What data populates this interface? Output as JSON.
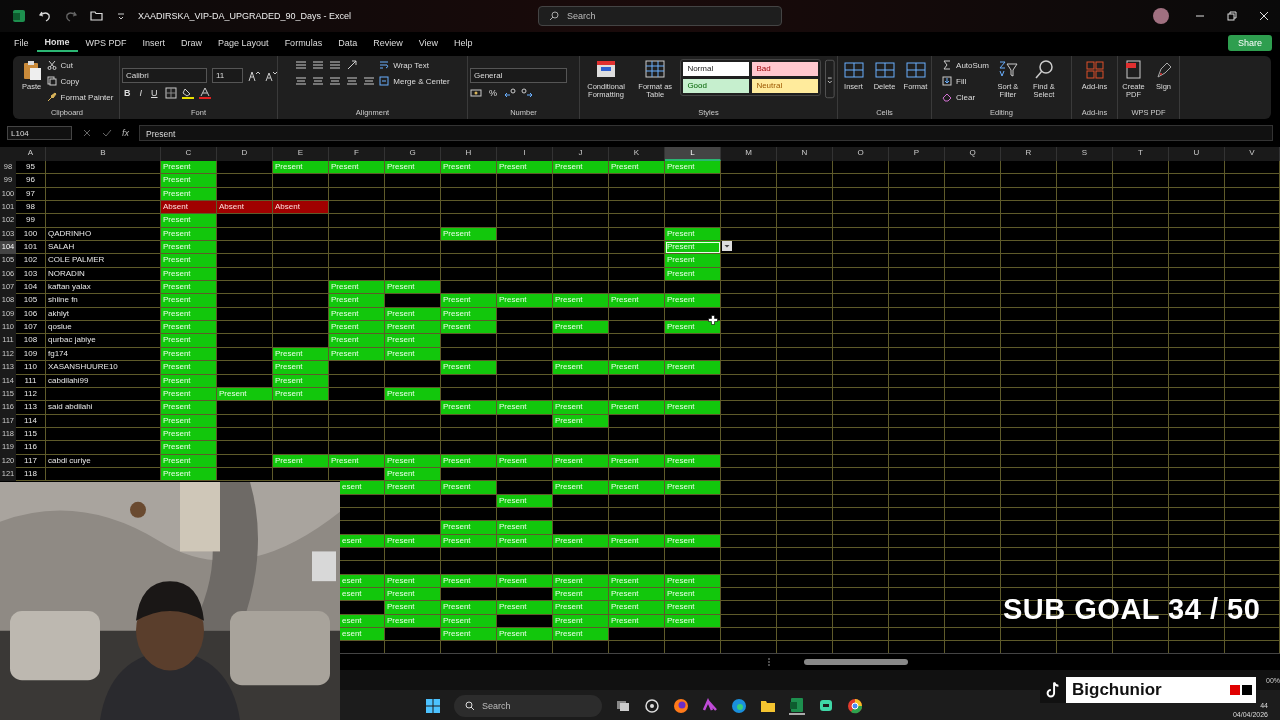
{
  "window": {
    "title": "XAADIRSKA_VIP-DA_UPGRADED_90_Days  -  Excel",
    "search": {
      "placeholder": "Search"
    }
  },
  "menu": [
    {
      "label": "File",
      "selected": false
    },
    {
      "label": "Home",
      "selected": true
    },
    {
      "label": "WPS PDF",
      "selected": false
    },
    {
      "label": "Insert",
      "selected": false
    },
    {
      "label": "Draw",
      "selected": false
    },
    {
      "label": "Page Layout",
      "selected": false
    },
    {
      "label": "Formulas",
      "selected": false
    },
    {
      "label": "Data",
      "selected": false
    },
    {
      "label": "Review",
      "selected": false
    },
    {
      "label": "View",
      "selected": false
    },
    {
      "label": "Help",
      "selected": false
    }
  ],
  "share": "Share",
  "ribbon": {
    "clipboard": {
      "label": "Clipboard",
      "paste": "Paste",
      "cut": "Cut",
      "copy": "Copy",
      "format_painter": "Format Painter"
    },
    "font": {
      "label": "Font",
      "family": "Calibri",
      "size": "11",
      "bold": "B",
      "italic": "I",
      "underline": "U"
    },
    "alignment": {
      "label": "Alignment",
      "wrap": "Wrap Text",
      "merge": "Merge & Center"
    },
    "number": {
      "label": "Number",
      "format": "General",
      "percent": "%"
    },
    "styles": {
      "label": "Styles",
      "conditional": "Conditional Formatting",
      "format_table": "Format as Table",
      "cell_styles": [
        {
          "text": "Normal",
          "color": "#ffffff"
        },
        {
          "text": "Bad",
          "color": "#ffc7ce"
        },
        {
          "text": "Good",
          "color": "#c6efce"
        },
        {
          "text": "Neutral",
          "color": "#ffeb9c"
        }
      ]
    },
    "cells": {
      "label": "Cells",
      "buttons": [
        "Insert",
        "Delete",
        "Format"
      ]
    },
    "editing": {
      "label": "Editing",
      "autosum": "AutoSum",
      "fill": "Fill",
      "clear": "Clear",
      "sort": "Sort & Filter",
      "find": "Find & Select"
    },
    "addins": {
      "label": "Add-ins",
      "button": "Add-ins"
    },
    "wps": {
      "label": "WPS PDF",
      "create": "Create PDF",
      "sign": "Sign"
    }
  },
  "formula_bar": {
    "name_box": "L104",
    "fx": "fx",
    "value": "Present"
  },
  "grid": {
    "columns": [
      {
        "label": "A",
        "selected": false
      },
      {
        "label": "B",
        "selected": false
      },
      {
        "label": "C",
        "selected": false
      },
      {
        "label": "D",
        "selected": false
      },
      {
        "label": "E",
        "selected": false
      },
      {
        "label": "F",
        "selected": false
      },
      {
        "label": "G",
        "selected": false
      },
      {
        "label": "H",
        "selected": false
      },
      {
        "label": "I",
        "selected": false
      },
      {
        "label": "J",
        "selected": false
      },
      {
        "label": "K",
        "selected": false
      },
      {
        "label": "L",
        "selected": true
      },
      {
        "label": "M",
        "selected": false
      },
      {
        "label": "N",
        "selected": false
      },
      {
        "label": "O",
        "selected": false
      },
      {
        "label": "P",
        "selected": false
      },
      {
        "label": "Q",
        "selected": false
      },
      {
        "label": "R",
        "selected": false
      },
      {
        "label": "S",
        "selected": false
      },
      {
        "label": "T",
        "selected": false
      },
      {
        "label": "U",
        "selected": false
      },
      {
        "label": "V",
        "selected": false
      }
    ],
    "rows": [
      {
        "header": "98",
        "selected": false,
        "cells": [
          "95",
          "",
          {
            "text": "Present",
            "kind": "present"
          },
          "",
          {
            "text": "Present",
            "kind": "present"
          },
          {
            "text": "Present",
            "kind": "present"
          },
          {
            "text": "Present",
            "kind": "present"
          },
          {
            "text": "Present",
            "kind": "present"
          },
          {
            "text": "Present",
            "kind": "present"
          },
          {
            "text": "Present",
            "kind": "present"
          },
          {
            "text": "Present",
            "kind": "present"
          },
          {
            "text": "Present",
            "kind": "present"
          }
        ]
      },
      {
        "header": "99",
        "selected": false,
        "cells": [
          "96",
          "",
          {
            "text": "Present",
            "kind": "present"
          }
        ]
      },
      {
        "header": "100",
        "selected": false,
        "cells": [
          "97",
          "",
          {
            "text": "Present",
            "kind": "present"
          }
        ]
      },
      {
        "header": "101",
        "selected": false,
        "cells": [
          "98",
          "",
          {
            "text": "Absent",
            "kind": "absent"
          },
          {
            "text": "Absent",
            "kind": "absent"
          },
          {
            "text": "Absent",
            "kind": "absent"
          }
        ]
      },
      {
        "header": "102",
        "selected": false,
        "cells": [
          "99",
          "",
          {
            "text": "Present",
            "kind": "present"
          }
        ]
      },
      {
        "header": "103",
        "selected": false,
        "cells": [
          "100",
          "QADRINHO",
          {
            "text": "Present",
            "kind": "present"
          },
          "",
          "",
          "",
          "",
          {
            "text": "Present",
            "kind": "present"
          },
          "",
          "",
          "",
          {
            "text": "Present",
            "kind": "present"
          }
        ]
      },
      {
        "header": "104",
        "selected": true,
        "cells": [
          "101",
          "SALAH",
          {
            "text": "Present",
            "kind": "present"
          },
          "",
          "",
          "",
          "",
          "",
          "",
          "",
          "",
          {
            "text": "Present",
            "kind": "present"
          }
        ]
      },
      {
        "header": "105",
        "selected": false,
        "cells": [
          "102",
          "COLE PALMER",
          {
            "text": "Present",
            "kind": "present"
          },
          "",
          "",
          "",
          "",
          "",
          "",
          "",
          "",
          {
            "text": "Present",
            "kind": "present"
          }
        ]
      },
      {
        "header": "106",
        "selected": false,
        "cells": [
          "103",
          "NORADIN",
          {
            "text": "Present",
            "kind": "present"
          },
          "",
          "",
          "",
          "",
          "",
          "",
          "",
          "",
          {
            "text": "Present",
            "kind": "present"
          }
        ]
      },
      {
        "header": "107",
        "selected": false,
        "cells": [
          "104",
          "kaftan yalax",
          {
            "text": "Present",
            "kind": "present"
          },
          "",
          "",
          {
            "text": "Present",
            "kind": "present"
          },
          {
            "text": "Present",
            "kind": "present"
          }
        ]
      },
      {
        "header": "108",
        "selected": false,
        "cells": [
          "105",
          "shiine fn",
          {
            "text": "Present",
            "kind": "present"
          },
          "",
          "",
          {
            "text": "Present",
            "kind": "present"
          },
          "",
          {
            "text": "Present",
            "kind": "present"
          },
          {
            "text": "Present",
            "kind": "present"
          },
          {
            "text": "Present",
            "kind": "present"
          },
          {
            "text": "Present",
            "kind": "present"
          },
          {
            "text": "Present",
            "kind": "present"
          }
        ]
      },
      {
        "header": "109",
        "selected": false,
        "cells": [
          "106",
          "akhlyt",
          {
            "text": "Present",
            "kind": "present"
          },
          "",
          "",
          {
            "text": "Present",
            "kind": "present"
          },
          {
            "text": "Present",
            "kind": "present"
          },
          {
            "text": "Present",
            "kind": "present"
          }
        ]
      },
      {
        "header": "110",
        "selected": false,
        "cells": [
          "107",
          "qoslue",
          {
            "text": "Present",
            "kind": "present"
          },
          "",
          "",
          {
            "text": "Present",
            "kind": "present"
          },
          {
            "text": "Present",
            "kind": "present"
          },
          {
            "text": "Present",
            "kind": "present"
          },
          "",
          {
            "text": "Present",
            "kind": "present"
          },
          "",
          {
            "text": "Present",
            "kind": "present"
          }
        ]
      },
      {
        "header": "111",
        "selected": false,
        "cells": [
          "108",
          "qurbac jabiye",
          {
            "text": "Present",
            "kind": "present"
          },
          "",
          "",
          {
            "text": "Present",
            "kind": "present"
          },
          {
            "text": "Present",
            "kind": "present"
          }
        ]
      },
      {
        "header": "112",
        "selected": false,
        "cells": [
          "109",
          "fg174",
          {
            "text": "Present",
            "kind": "present"
          },
          "",
          {
            "text": "Present",
            "kind": "present"
          },
          {
            "text": "Present",
            "kind": "present"
          },
          {
            "text": "Present",
            "kind": "present"
          }
        ]
      },
      {
        "header": "113",
        "selected": false,
        "cells": [
          "110",
          "XASANSHUURE10",
          {
            "text": "Present",
            "kind": "present"
          },
          "",
          {
            "text": "Present",
            "kind": "present"
          },
          "",
          "",
          {
            "text": "Present",
            "kind": "present"
          },
          "",
          {
            "text": "Present",
            "kind": "present"
          },
          {
            "text": "Present",
            "kind": "present"
          },
          {
            "text": "Present",
            "kind": "present"
          }
        ]
      },
      {
        "header": "114",
        "selected": false,
        "cells": [
          "111",
          "cabdilahi99",
          {
            "text": "Present",
            "kind": "present"
          },
          "",
          {
            "text": "Present",
            "kind": "present"
          }
        ]
      },
      {
        "header": "115",
        "selected": false,
        "cells": [
          "112",
          "",
          {
            "text": "Present",
            "kind": "present"
          },
          {
            "text": "Present",
            "kind": "present"
          },
          {
            "text": "Present",
            "kind": "present"
          },
          "",
          {
            "text": "Present",
            "kind": "present"
          }
        ]
      },
      {
        "header": "116",
        "selected": false,
        "cells": [
          "113",
          "said abdilahi",
          {
            "text": "Present",
            "kind": "present"
          },
          "",
          "",
          "",
          "",
          {
            "text": "Present",
            "kind": "present"
          },
          {
            "text": "Present",
            "kind": "present"
          },
          {
            "text": "Present",
            "kind": "present"
          },
          {
            "text": "Present",
            "kind": "present"
          },
          {
            "text": "Present",
            "kind": "present"
          }
        ]
      },
      {
        "header": "117",
        "selected": false,
        "cells": [
          "114",
          "",
          {
            "text": "Present",
            "kind": "present"
          },
          "",
          "",
          "",
          "",
          "",
          "",
          {
            "text": "Present",
            "kind": "present"
          }
        ]
      },
      {
        "header": "118",
        "selected": false,
        "cells": [
          "115",
          "",
          {
            "text": "Present",
            "kind": "present"
          }
        ]
      },
      {
        "header": "119",
        "selected": false,
        "cells": [
          "116",
          "",
          {
            "text": "Present",
            "kind": "present"
          }
        ]
      },
      {
        "header": "120",
        "selected": false,
        "cells": [
          "117",
          "cabdi curiye",
          {
            "text": "Present",
            "kind": "present"
          },
          "",
          {
            "text": "Present",
            "kind": "present"
          },
          {
            "text": "Present",
            "kind": "present"
          },
          {
            "text": "Present",
            "kind": "present"
          },
          {
            "text": "Present",
            "kind": "present"
          },
          {
            "text": "Present",
            "kind": "present"
          },
          {
            "text": "Present",
            "kind": "present"
          },
          {
            "text": "Present",
            "kind": "present"
          },
          {
            "text": "Present",
            "kind": "present"
          }
        ]
      },
      {
        "header": "121",
        "selected": false,
        "cells": [
          "118",
          "",
          {
            "text": "Present",
            "kind": "present"
          },
          "",
          "",
          "",
          {
            "text": "Present",
            "kind": "present"
          }
        ]
      }
    ],
    "covered_rows": [
      {
        "cells": [
          {
            "text": "esent",
            "kind": "present"
          },
          {
            "text": "Present",
            "kind": "present"
          },
          {
            "text": "Present",
            "kind": "present"
          },
          "",
          {
            "text": "Present",
            "kind": "present"
          },
          {
            "text": "Present",
            "kind": "present"
          },
          {
            "text": "Present",
            "kind": "present"
          }
        ]
      },
      {
        "cells": [
          "",
          "",
          "",
          {
            "text": "Present",
            "kind": "present"
          }
        ]
      },
      {
        "cells": []
      },
      {
        "cells": [
          "",
          "",
          {
            "text": "Present",
            "kind": "present"
          },
          {
            "text": "Present",
            "kind": "present"
          }
        ]
      },
      {
        "cells": [
          {
            "text": "esent",
            "kind": "present"
          },
          {
            "text": "Present",
            "kind": "present"
          },
          {
            "text": "Present",
            "kind": "present"
          },
          {
            "text": "Present",
            "kind": "present"
          },
          {
            "text": "Present",
            "kind": "present"
          },
          {
            "text": "Present",
            "kind": "present"
          },
          {
            "text": "Present",
            "kind": "present"
          }
        ]
      },
      {
        "cells": []
      },
      {
        "cells": []
      },
      {
        "cells": [
          {
            "text": "esent",
            "kind": "present"
          },
          {
            "text": "Present",
            "kind": "present"
          },
          {
            "text": "Present",
            "kind": "present"
          },
          {
            "text": "Present",
            "kind": "present"
          },
          {
            "text": "Present",
            "kind": "present"
          },
          {
            "text": "Present",
            "kind": "present"
          },
          {
            "text": "Present",
            "kind": "present"
          }
        ]
      },
      {
        "cells": [
          {
            "text": "esent",
            "kind": "present"
          },
          {
            "text": "Present",
            "kind": "present"
          },
          "",
          "",
          {
            "text": "Present",
            "kind": "present"
          },
          {
            "text": "Present",
            "kind": "present"
          },
          {
            "text": "Present",
            "kind": "present"
          }
        ]
      },
      {
        "cells": [
          "",
          {
            "text": "Present",
            "kind": "present"
          },
          {
            "text": "Present",
            "kind": "present"
          },
          {
            "text": "Present",
            "kind": "present"
          },
          {
            "text": "Present",
            "kind": "present"
          },
          {
            "text": "Present",
            "kind": "present"
          },
          {
            "text": "Present",
            "kind": "present"
          }
        ]
      },
      {
        "cells": [
          {
            "text": "esent",
            "kind": "present"
          },
          {
            "text": "Present",
            "kind": "present"
          },
          {
            "text": "Present",
            "kind": "present"
          },
          "",
          {
            "text": "Present",
            "kind": "present"
          },
          {
            "text": "Present",
            "kind": "present"
          },
          {
            "text": "Present",
            "kind": "present"
          }
        ]
      },
      {
        "cells": [
          {
            "text": "esent",
            "kind": "present"
          },
          "",
          {
            "text": "Present",
            "kind": "present"
          },
          {
            "text": "Present",
            "kind": "present"
          },
          {
            "text": "Present",
            "kind": "present"
          }
        ]
      },
      {
        "cells": []
      }
    ]
  },
  "status_bar": {
    "zoom": "00%"
  },
  "overlay": {
    "goal": "SUB GOAL 34 / 50",
    "channel": "Bigchunior"
  },
  "taskbar": {
    "search": {
      "placeholder": "Search"
    },
    "clock": "44",
    "date": "04/04/2026"
  }
}
